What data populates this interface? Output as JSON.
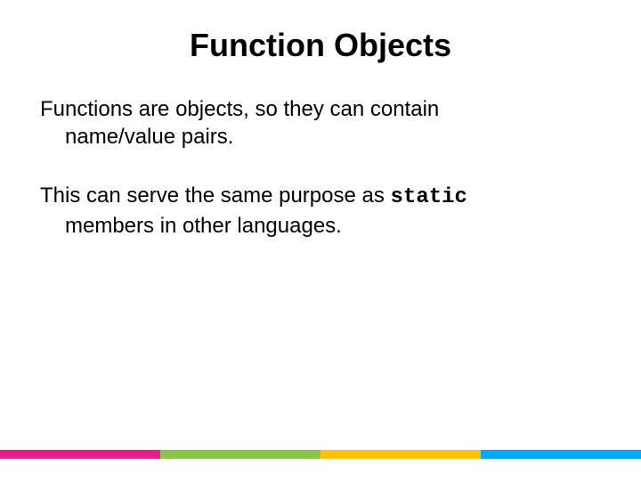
{
  "title": "Function Objects",
  "para1_line1": "Functions are objects, so they can contain",
  "para1_line2": "name/value pairs.",
  "para2_prefix": "This can serve the same purpose as ",
  "para2_code": "static",
  "para2_line2": "members in other languages.",
  "stripes": {
    "c1": "#e91e8c",
    "c2": "#8bc34a",
    "c3": "#ffc107",
    "c4": "#03a9f4"
  }
}
